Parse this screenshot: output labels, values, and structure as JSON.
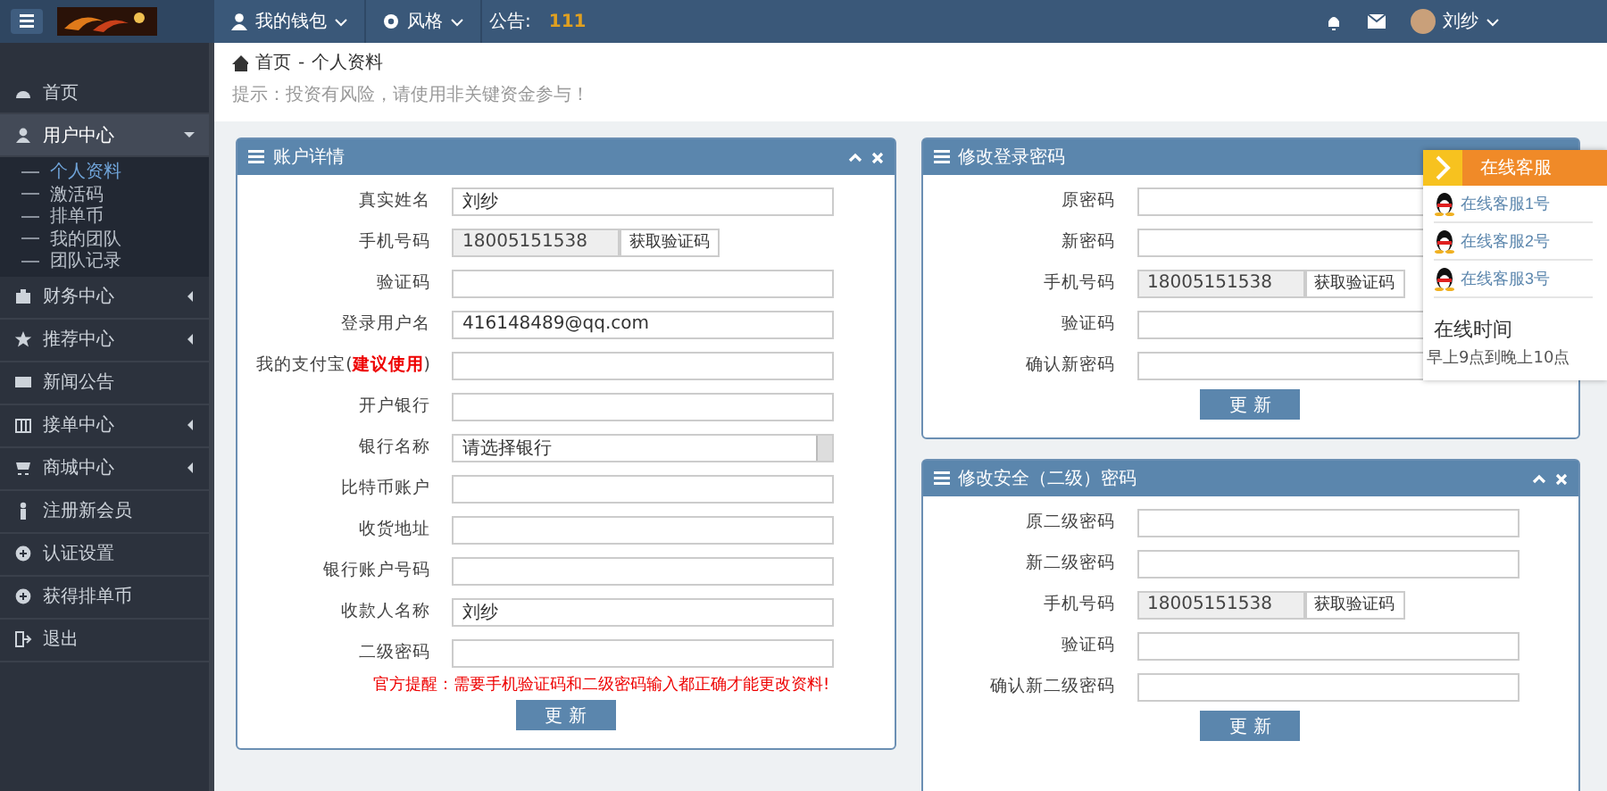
{
  "topbar": {
    "menus": [
      {
        "label": "我的钱包"
      },
      {
        "label": "风格"
      }
    ],
    "notice_label": "公告:",
    "notice": "111",
    "user": "刘纱"
  },
  "sidebar": {
    "items": [
      {
        "label": "首页"
      },
      {
        "label": "用户中心",
        "expanded": true,
        "children": [
          {
            "label": "个人资料",
            "selected": true
          },
          {
            "label": "激活码",
            "selected": false
          },
          {
            "label": "排单币",
            "selected": false
          },
          {
            "label": "我的团队",
            "selected": false
          },
          {
            "label": "团队记录",
            "selected": false
          }
        ]
      },
      {
        "label": "财务中心",
        "expanded": false
      },
      {
        "label": "推荐中心",
        "expanded": false
      },
      {
        "label": "新闻公告"
      },
      {
        "label": "接单中心",
        "expanded": false
      },
      {
        "label": "商城中心",
        "expanded": false
      },
      {
        "label": "注册新会员"
      },
      {
        "label": "认证设置"
      },
      {
        "label": "获得排单币"
      },
      {
        "label": "退出"
      }
    ]
  },
  "breadcrumb": [
    "首页",
    "个人资料"
  ],
  "breadcrumb_separator": "-",
  "tip": "提示：投资有风险，请使用非关键资金参与！",
  "panels": [
    {
      "title": "账户详情",
      "fields": [
        {
          "kind": "text",
          "label": "真实姓名",
          "value": "刘纱"
        },
        {
          "kind": "phone",
          "label": "手机号码",
          "value": "18005151538",
          "button": "获取验证码"
        },
        {
          "kind": "text",
          "label": "验证码"
        },
        {
          "kind": "text",
          "label": "登录用户名",
          "value": "416148489@qq.com"
        },
        {
          "kind": "text",
          "label": "我的支付宝(**建议使用**)"
        },
        {
          "kind": "text",
          "label": "开户银行"
        },
        {
          "kind": "select",
          "label": "银行名称",
          "value": "请选择银行"
        },
        {
          "kind": "text",
          "label": "比特币账户"
        },
        {
          "kind": "text",
          "label": "收货地址"
        },
        {
          "kind": "text",
          "label": "银行账户号码"
        },
        {
          "kind": "text",
          "label": "收款人名称",
          "value": "刘纱"
        },
        {
          "kind": "text",
          "label": "二级密码"
        }
      ],
      "note": "官方提醒：需要手机验证码和二级密码输入都正确才能更改资料!",
      "submit": "更 新"
    },
    {
      "title": "修改登录密码",
      "fields": [
        {
          "kind": "text",
          "label": "原密码"
        },
        {
          "kind": "text",
          "label": "新密码"
        },
        {
          "kind": "phone",
          "label": "手机号码",
          "value": "18005151538",
          "button": "获取验证码"
        },
        {
          "kind": "text",
          "label": "验证码"
        },
        {
          "kind": "text",
          "label": "确认新密码"
        }
      ],
      "submit": "更 新"
    },
    {
      "title": "修改安全（二级）密码",
      "fields": [
        {
          "kind": "text",
          "label": "原二级密码"
        },
        {
          "kind": "text",
          "label": "新二级密码"
        },
        {
          "kind": "phone",
          "label": "手机号码",
          "value": "18005151538",
          "button": "获取验证码"
        },
        {
          "kind": "text",
          "label": "验证码"
        },
        {
          "kind": "text",
          "label": "确认新二级密码"
        }
      ],
      "submit": "更 新"
    }
  ],
  "chat": {
    "title": "在线客服",
    "agents": [
      {
        "label": "在线客服1号"
      },
      {
        "label": "在线客服2号"
      },
      {
        "label": "在线客服3号"
      }
    ],
    "hours_title": "在线时间",
    "hours": "早上9点到晚上10点"
  }
}
